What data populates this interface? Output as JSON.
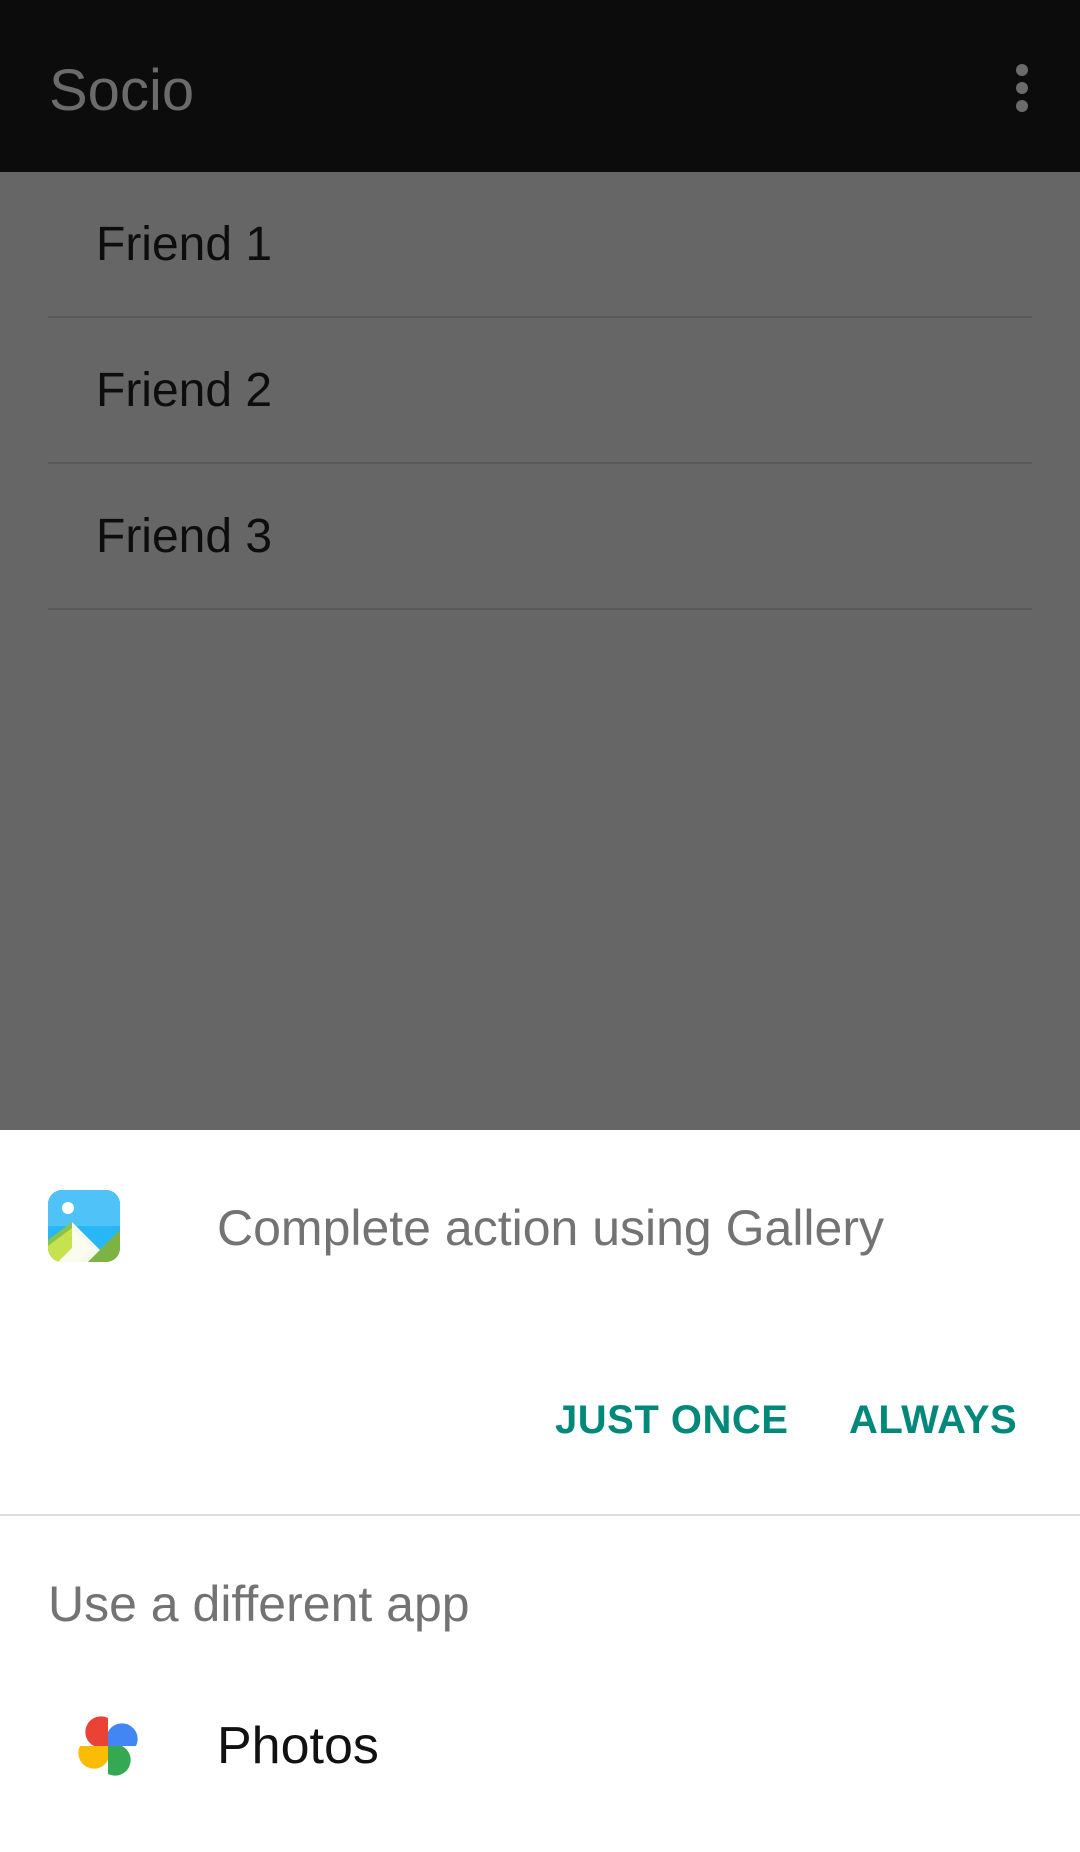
{
  "toolbar": {
    "title": "Socio",
    "overflow_icon": "more-vert-icon"
  },
  "friends": [
    {
      "label": "Friend 1"
    },
    {
      "label": "Friend 2"
    },
    {
      "label": "Friend 3"
    }
  ],
  "chooser": {
    "title": "Complete action using Gallery",
    "app_icon": "gallery-icon",
    "just_once_label": "JUST ONCE",
    "always_label": "ALWAYS",
    "subheader": "Use a different app",
    "apps": [
      {
        "label": "Photos",
        "icon": "photos-pinwheel-icon"
      }
    ]
  },
  "colors": {
    "accent": "#00897b",
    "toolbar_bg": "#0c0c0c",
    "scrim": "#666666"
  }
}
